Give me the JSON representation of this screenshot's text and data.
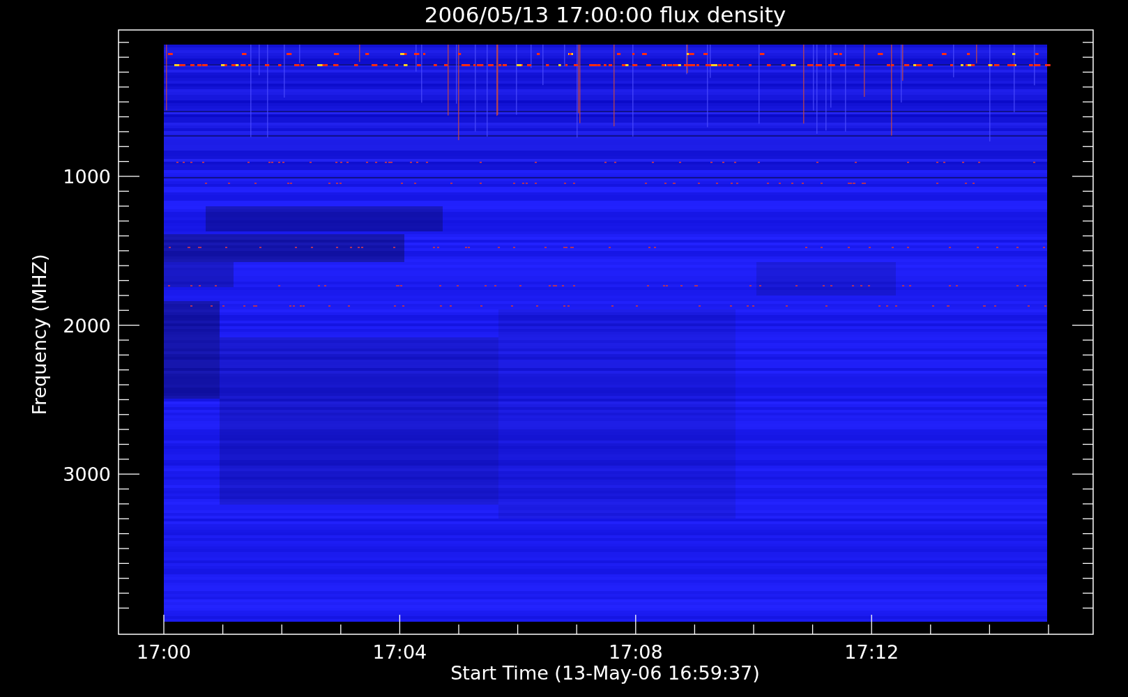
{
  "plot": {
    "title": "2006/05/13 17:00:00 flux density",
    "xlabel": "Start Time (13-May-06 16:59:37)",
    "ylabel": "Frequency (MHZ)",
    "xtick_labels": [
      "17:00",
      "17:04",
      "17:08",
      "17:12"
    ],
    "ytick_labels": [
      "1000",
      "2000",
      "3000"
    ]
  }
}
